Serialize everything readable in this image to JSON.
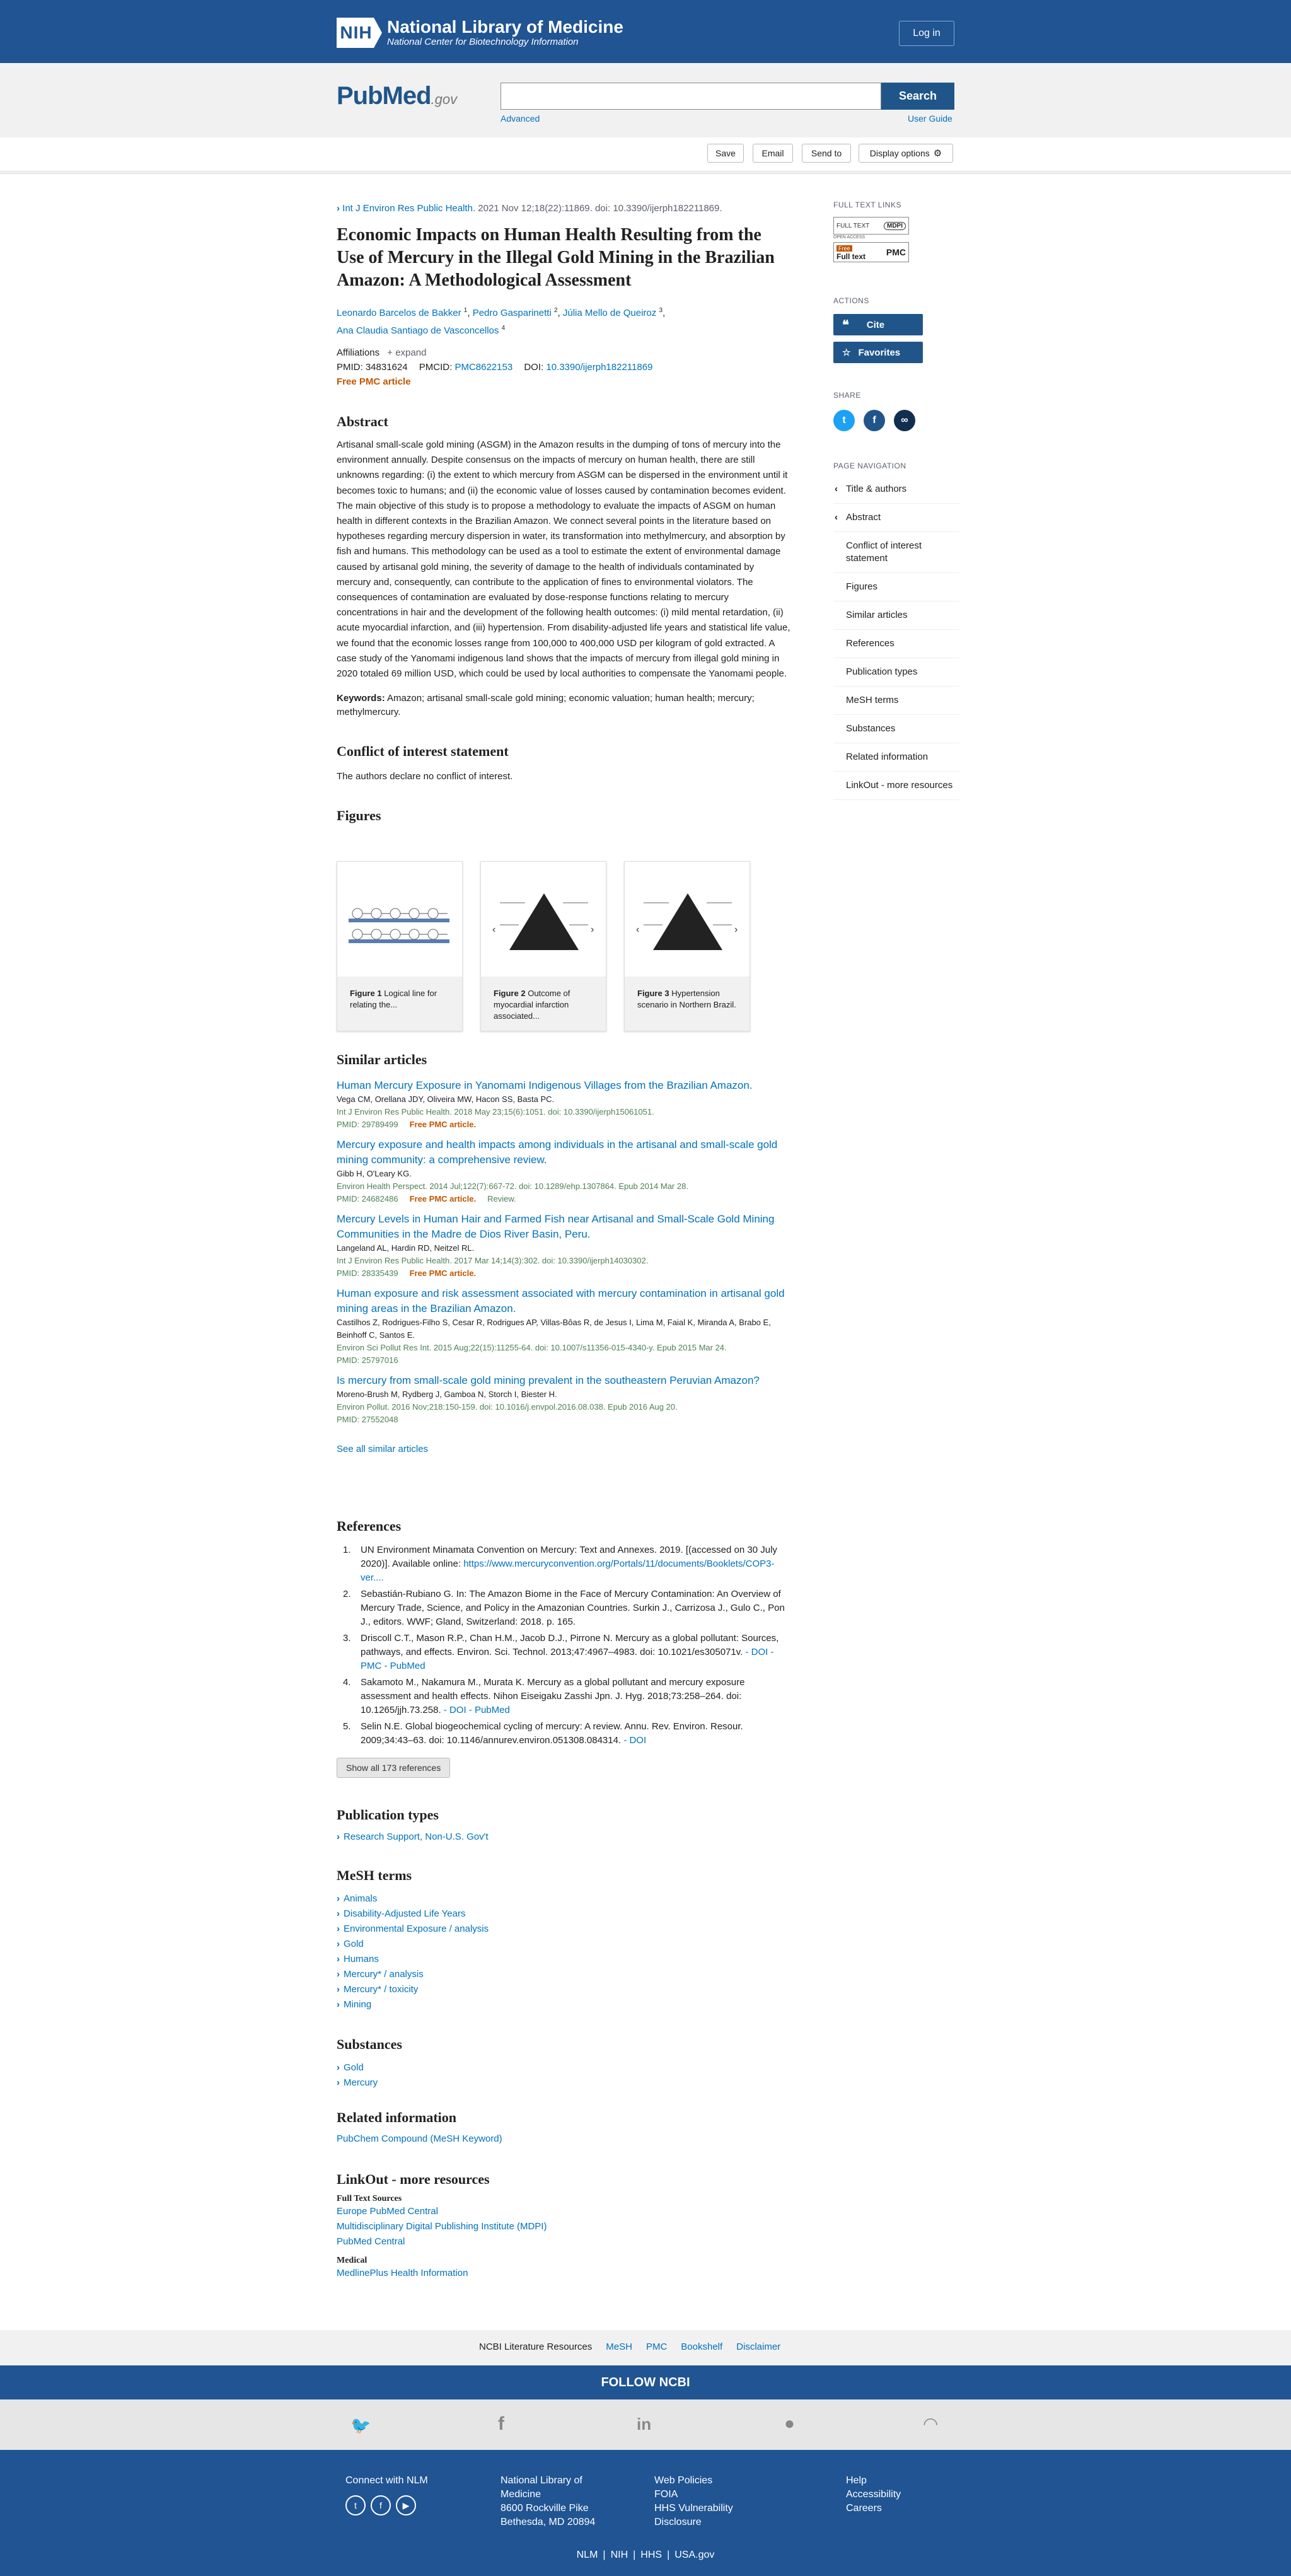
{
  "header": {
    "badge": "NIH",
    "title": "National Library of Medicine",
    "subtitle": "National Center for Biotechnology Information",
    "login": "Log in"
  },
  "search": {
    "logo_main": "PubMed",
    "logo_suffix": ".gov",
    "placeholder": "",
    "button": "Search",
    "advanced": "Advanced",
    "user_guide": "User Guide"
  },
  "actions": {
    "save": "Save",
    "email": "Email",
    "send_to": "Send to",
    "display_options": "Display options"
  },
  "article": {
    "journal": "Int J Environ Res Public Health",
    "citation": ". 2021 Nov 12;18(22):11869. doi: 10.3390/ijerph182211869.",
    "title": "Economic Impacts on Human Health Resulting from the Use of Mercury in the Illegal Gold Mining in the Brazilian Amazon: A Methodological Assessment",
    "authors": [
      {
        "name": "Leonardo Barcelos de Bakker",
        "sup": "1"
      },
      {
        "name": "Pedro Gasparinetti",
        "sup": "2"
      },
      {
        "name": "Júlia Mello de Queiroz",
        "sup": "3"
      },
      {
        "name": "Ana Claudia Santiago de Vasconcellos",
        "sup": "4"
      }
    ],
    "affiliations_label": "Affiliations",
    "expand": "expand",
    "pmid_label": "PMID:",
    "pmid": "34831624",
    "pmcid_label": "PMCID:",
    "pmcid": "PMC8622153",
    "doi_label": "DOI:",
    "doi": "10.3390/ijerph182211869",
    "free_pmc": "Free PMC article",
    "abstract_heading": "Abstract",
    "abstract": "Artisanal small-scale gold mining (ASGM) in the Amazon results in the dumping of tons of mercury into the environment annually. Despite consensus on the impacts of mercury on human health, there are still unknowns regarding: (i) the extent to which mercury from ASGM can be dispersed in the environment until it becomes toxic to humans; and (ii) the economic value of losses caused by contamination becomes evident. The main objective of this study is to propose a methodology to evaluate the impacts of ASGM on human health in different contexts in the Brazilian Amazon. We connect several points in the literature based on hypotheses regarding mercury dispersion in water, its transformation into methylmercury, and absorption by fish and humans. This methodology can be used as a tool to estimate the extent of environmental damage caused by artisanal gold mining, the severity of damage to the health of individuals contaminated by mercury and, consequently, can contribute to the application of fines to environmental violators. The consequences of contamination are evaluated by dose-response functions relating to mercury concentrations in hair and the development of the following health outcomes: (i) mild mental retardation, (ii) acute myocardial infarction, and (iii) hypertension. From disability-adjusted life years and statistical life value, we found that the economic losses range from 100,000 to 400,000 USD per kilogram of gold extracted. A case study of the Yanomami indigenous land shows that the impacts of mercury from illegal gold mining in 2020 totaled 69 million USD, which could be used by local authorities to compensate the Yanomami people.",
    "keywords_label": "Keywords:",
    "keywords": "Amazon; artisanal small-scale gold mining; economic valuation; human health; mercury; methylmercury.",
    "coi_heading": "Conflict of interest statement",
    "coi": "The authors declare no conflict of interest.",
    "figures_heading": "Figures",
    "figures": [
      {
        "label": "Figure 1",
        "caption": "Logical line for relating the..."
      },
      {
        "label": "Figure 2",
        "caption": "Outcome of myocardial infarction associated..."
      },
      {
        "label": "Figure 3",
        "caption": "Hypertension scenario in Northern Brazil."
      }
    ]
  },
  "similar": {
    "heading": "Similar articles",
    "items": [
      {
        "title": "Human Mercury Exposure in Yanomami Indigenous Villages from the Brazilian Amazon.",
        "authors": "Vega CM, Orellana JDY, Oliveira MW, Hacon SS, Basta PC.",
        "citation": "Int J Environ Res Public Health. 2018 May 23;15(6):1051. doi: 10.3390/ijerph15061051.",
        "pmid": "PMID: 29789499",
        "free": "Free PMC article.",
        "review": ""
      },
      {
        "title": "Mercury exposure and health impacts among individuals in the artisanal and small-scale gold mining community: a comprehensive review.",
        "authors": "Gibb H, O'Leary KG.",
        "citation": "Environ Health Perspect. 2014 Jul;122(7):667-72. doi: 10.1289/ehp.1307864. Epub 2014 Mar 28.",
        "pmid": "PMID: 24682486",
        "free": "Free PMC article.",
        "review": "Review."
      },
      {
        "title": "Mercury Levels in Human Hair and Farmed Fish near Artisanal and Small-Scale Gold Mining Communities in the Madre de Dios River Basin, Peru.",
        "authors": "Langeland AL, Hardin RD, Neitzel RL.",
        "citation": "Int J Environ Res Public Health. 2017 Mar 14;14(3):302. doi: 10.3390/ijerph14030302.",
        "pmid": "PMID: 28335439",
        "free": "Free PMC article.",
        "review": ""
      },
      {
        "title": "Human exposure and risk assessment associated with mercury contamination in artisanal gold mining areas in the Brazilian Amazon.",
        "authors": "Castilhos Z, Rodrigues-Filho S, Cesar R, Rodrigues AP, Villas-Bôas R, de Jesus I, Lima M, Faial K, Miranda A, Brabo E, Beinhoff C, Santos E.",
        "citation": "Environ Sci Pollut Res Int. 2015 Aug;22(15):11255-64. doi: 10.1007/s11356-015-4340-y. Epub 2015 Mar 24.",
        "pmid": "PMID: 25797016",
        "free": "",
        "review": ""
      },
      {
        "title": "Is mercury from small-scale gold mining prevalent in the southeastern Peruvian Amazon?",
        "authors": "Moreno-Brush M, Rydberg J, Gamboa N, Storch I, Biester H.",
        "citation": "Environ Pollut. 2016 Nov;218:150-159. doi: 10.1016/j.envpol.2016.08.038. Epub 2016 Aug 20.",
        "pmid": "PMID: 27552048",
        "free": "",
        "review": ""
      }
    ],
    "see_all": "See all similar articles"
  },
  "references": {
    "heading": "References",
    "items": [
      {
        "num": "1.",
        "text": "UN Environment Minamata Convention on Mercury: Text and Annexes. 2019. [(accessed on 30 July 2020)]. Available online:",
        "link": "https://www.mercuryconvention.org/Portals/11/documents/Booklets/COP3-ver....",
        "extra": ""
      },
      {
        "num": "2.",
        "text": "Sebastián-Rubiano G. In: The Amazon Biome in the Face of Mercury Contamination: An Overview of Mercury Trade, Science, and Policy in the Amazonian Countries. Surkin J., Carrizosa J., Gulo C., Pon J., editors. WWF; Gland, Switzerland: 2018. p. 165.",
        "link": "",
        "extra": ""
      },
      {
        "num": "3.",
        "text": "Driscoll C.T., Mason R.P., Chan H.M., Jacob D.J., Pirrone N. Mercury as a global pollutant: Sources, pathways, and effects. Environ. Sci. Technol. 2013;47:4967–4983. doi: 10.1021/es305071v.",
        "link": "",
        "extra": "- DOI - PMC - PubMed"
      },
      {
        "num": "4.",
        "text": "Sakamoto M., Nakamura M., Murata K. Mercury as a global pollutant and mercury exposure assessment and health effects. Nihon Eiseigaku Zasshi Jpn. J. Hyg. 2018;73:258–264. doi: 10.1265/jjh.73.258.",
        "link": "",
        "extra": "- DOI - PubMed"
      },
      {
        "num": "5.",
        "text": "Selin N.E. Global biogeochemical cycling of mercury: A review. Annu. Rev. Environ. Resour. 2009;34:43–63. doi: 10.1146/annurev.environ.051308.084314.",
        "link": "",
        "extra": "- DOI"
      }
    ],
    "show_all": "Show all 173 references"
  },
  "pubtypes": {
    "heading": "Publication types",
    "items": [
      "Research Support, Non-U.S. Gov't"
    ]
  },
  "mesh": {
    "heading": "MeSH terms",
    "items": [
      "Animals",
      "Disability-Adjusted Life Years",
      "Environmental Exposure / analysis",
      "Gold",
      "Humans",
      "Mercury* / analysis",
      "Mercury* / toxicity",
      "Mining"
    ]
  },
  "substances": {
    "heading": "Substances",
    "items": [
      "Gold",
      "Mercury"
    ]
  },
  "related": {
    "heading": "Related information",
    "items": [
      "PubChem Compound (MeSH Keyword)"
    ]
  },
  "linkout": {
    "heading": "LinkOut - more resources",
    "fts_heading": "Full Text Sources",
    "fts": [
      "Europe PubMed Central",
      "Multidisciplinary Digital Publishing Institute (MDPI)",
      "PubMed Central"
    ],
    "med_heading": "Medical",
    "med": [
      "MedlinePlus Health Information"
    ]
  },
  "sidebar": {
    "full_text_heading": "FULL TEXT LINKS",
    "full_text_mdpi": "FULL TEXT",
    "mdpi": "MDPI",
    "open_access": "OPEN ACCESS",
    "free_label": "Free",
    "full_text_pmc": "Full text",
    "pmc": "PMC",
    "actions_heading": "ACTIONS",
    "cite": "Cite",
    "favorites": "Favorites",
    "share_heading": "SHARE",
    "page_nav_heading": "PAGE NAVIGATION",
    "nav": [
      "Title & authors",
      "Abstract",
      "Conflict of interest statement",
      "Figures",
      "Similar articles",
      "References",
      "Publication types",
      "MeSH terms",
      "Substances",
      "Related information",
      "LinkOut - more resources"
    ]
  },
  "footer": {
    "links": [
      "NCBI Literature Resources",
      "MeSH",
      "PMC",
      "Bookshelf",
      "Disclaimer"
    ],
    "follow": "FOLLOW NCBI",
    "connect": "Connect with NLM",
    "address": [
      "National Library of",
      "Medicine",
      "8600 Rockville Pike",
      "Bethesda, MD 20894"
    ],
    "policies": [
      "Web Policies",
      "FOIA",
      "HHS Vulnerability",
      "Disclosure"
    ],
    "help": [
      "Help",
      "Accessibility",
      "Careers"
    ],
    "bottom": [
      "NLM",
      "NIH",
      "HHS",
      "USA.gov"
    ]
  },
  "colors": {
    "brand": "#205493",
    "link": "#0071bc",
    "free": "#c05600",
    "citation": "#4d8055"
  }
}
